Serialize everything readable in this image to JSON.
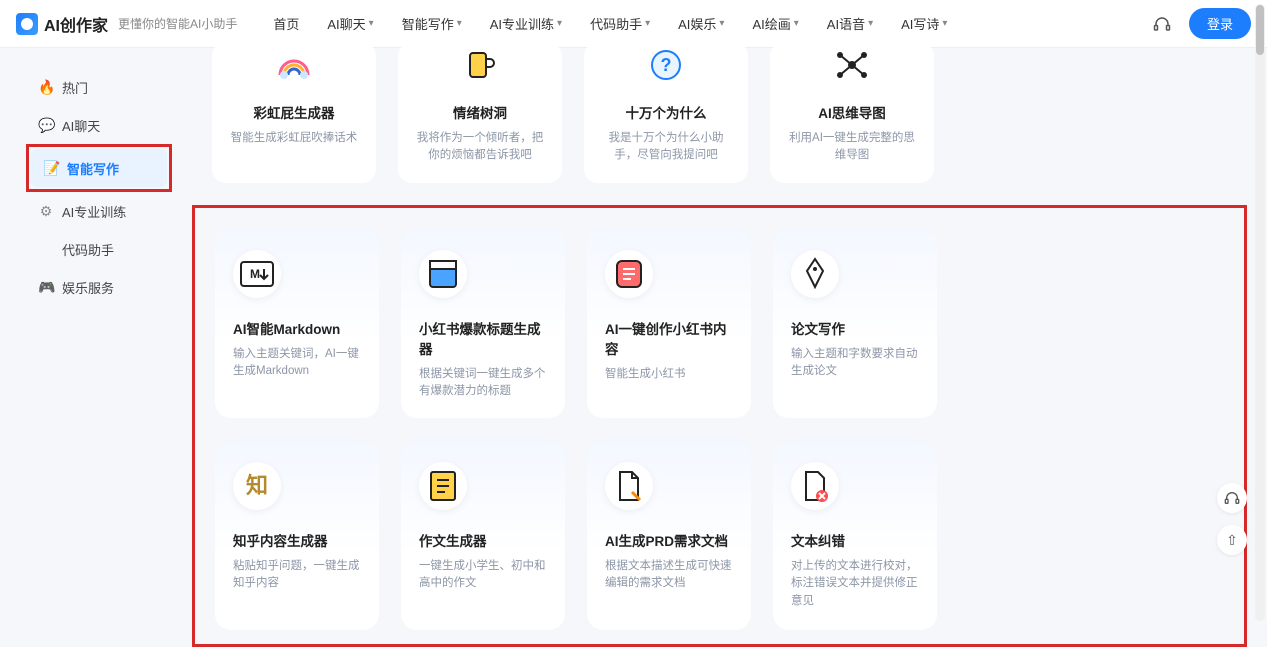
{
  "header": {
    "brand": "AI创作家",
    "tagline": "更懂你的智能AI小助手",
    "nav": [
      "首页",
      "AI聊天",
      "智能写作",
      "AI专业训练",
      "代码助手",
      "AI娱乐",
      "AI绘画",
      "AI语音",
      "AI写诗"
    ],
    "nav_has_chevron": [
      false,
      true,
      true,
      true,
      true,
      true,
      true,
      true,
      true
    ],
    "login": "登录"
  },
  "sidebar": {
    "items": [
      {
        "icon": "🔥",
        "label": "热门",
        "color": "#ff8a00"
      },
      {
        "icon": "💬",
        "label": "AI聊天",
        "color": "#2ab6ff"
      },
      {
        "icon": "📝",
        "label": "智能写作",
        "color": "#1d7efd",
        "active": true
      },
      {
        "icon": "⚙",
        "label": "AI专业训练",
        "color": "#888"
      },
      {
        "icon": "</>",
        "label": "代码助手",
        "color": "#1d7efd"
      },
      {
        "icon": "🎮",
        "label": "娱乐服务",
        "color": "#1d7efd"
      }
    ]
  },
  "top_row": [
    {
      "title": "彩虹屁生成器",
      "desc": "智能生成彩虹屁吹捧话术",
      "icon": "rainbow"
    },
    {
      "title": "情绪树洞",
      "desc": "我将作为一个倾听者，把你的烦恼都告诉我吧",
      "icon": "cup"
    },
    {
      "title": "十万个为什么",
      "desc": "我是十万个为什么小助手，尽管向我提问吧",
      "icon": "question"
    },
    {
      "title": "AI思维导图",
      "desc": "利用AI一键生成完整的思维导图",
      "icon": "mindmap"
    }
  ],
  "grid": [
    {
      "title": "AI智能Markdown",
      "desc": "输入主题关键词，AI一键生成Markdown",
      "icon": "markdown"
    },
    {
      "title": "小红书爆款标题生成器",
      "desc": "根据关键词一键生成多个有爆款潜力的标题",
      "icon": "window"
    },
    {
      "title": "AI一键创作小红书内容",
      "desc": "智能生成小红书",
      "icon": "note"
    },
    {
      "title": "论文写作",
      "desc": "输入主题和字数要求自动生成论文",
      "icon": "pen"
    },
    {
      "title": "知乎内容生成器",
      "desc": "粘贴知乎问题，一键生成知乎内容",
      "icon": "zhi"
    },
    {
      "title": "作文生成器",
      "desc": "一键生成小学生、初中和高中的作文",
      "icon": "doc"
    },
    {
      "title": "AI生成PRD需求文档",
      "desc": "根据文本描述生成可快速编辑的需求文档",
      "icon": "prd"
    },
    {
      "title": "文本纠错",
      "desc": "对上传的文本进行校对，标注错误文本并提供修正意见",
      "icon": "error"
    }
  ]
}
